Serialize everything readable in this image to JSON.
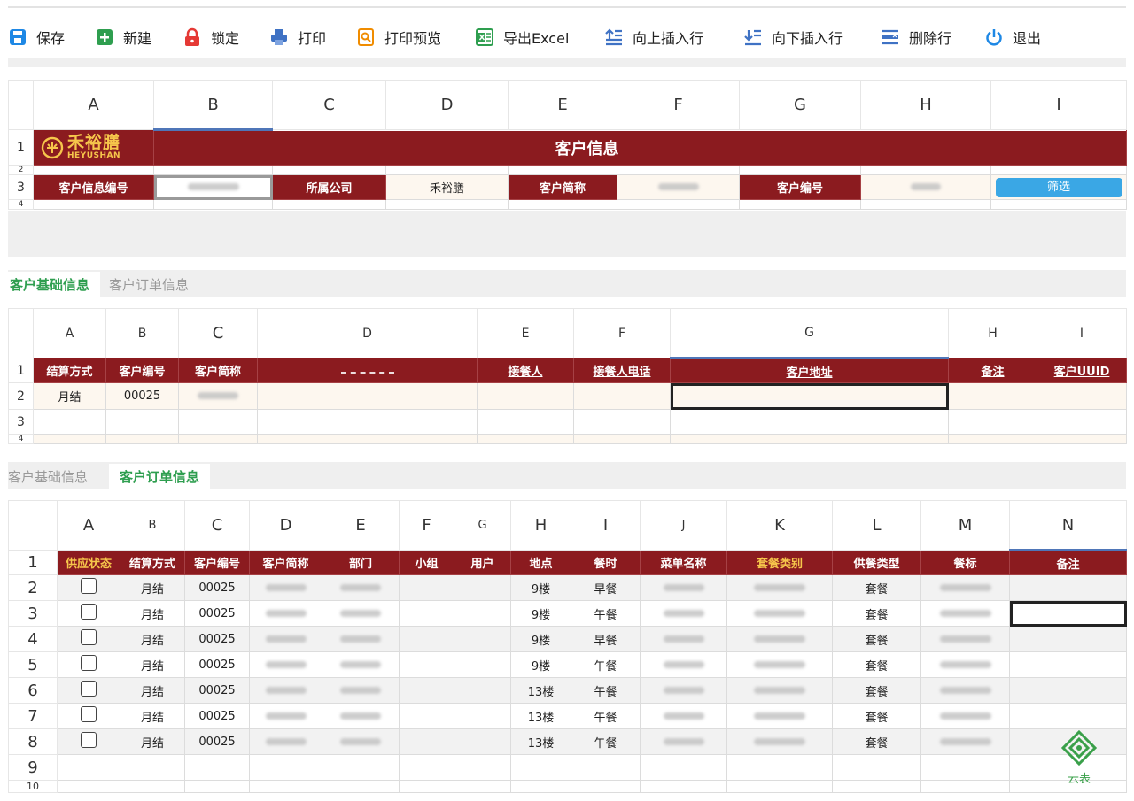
{
  "toolbar": {
    "buttons": [
      {
        "label": "保存",
        "icon": "save-icon",
        "color": "#1e88e5"
      },
      {
        "label": "新建",
        "icon": "new-icon",
        "color": "#2e9e4f"
      },
      {
        "label": "锁定",
        "icon": "lock-icon",
        "color": "#e53935"
      },
      {
        "label": "打印",
        "icon": "print-icon",
        "color": "#3f72c4"
      },
      {
        "label": "打印预览",
        "icon": "print-preview-icon",
        "color": "#f08c00"
      },
      {
        "label": "导出Excel",
        "icon": "excel-icon",
        "color": "#2e9e4f"
      },
      {
        "label": "向上插入行",
        "icon": "insert-row-above-icon",
        "color": "#3f72c4"
      },
      {
        "label": "向下插入行",
        "icon": "insert-row-below-icon",
        "color": "#3f72c4"
      },
      {
        "label": "删除行",
        "icon": "delete-row-icon",
        "color": "#3f72c4"
      },
      {
        "label": "退出",
        "icon": "power-icon",
        "color": "#1e88e5"
      }
    ]
  },
  "sheet1": {
    "cols": [
      "A",
      "B",
      "C",
      "D",
      "E",
      "F",
      "G",
      "H",
      "I"
    ],
    "rows": [
      "1",
      "2",
      "3",
      "4"
    ],
    "logo_cn": "禾裕膳",
    "logo_en": "HEYUSHAN",
    "title": "客户信息",
    "label_code": "客户信息编号",
    "label_company": "所属公司",
    "company_value": "禾裕膳",
    "label_short": "客户简称",
    "label_no": "客户编号",
    "filter_button": "筛选"
  },
  "tabs1": {
    "basic": "客户基础信息",
    "orders": "客户订单信息"
  },
  "sheet2": {
    "cols": [
      "A",
      "B",
      "C",
      "D",
      "E",
      "F",
      "G",
      "H",
      "I"
    ],
    "rows": [
      "1",
      "2",
      "3",
      "4"
    ],
    "headers": [
      "结算方式",
      "客户编号",
      "客户简称",
      "",
      "接餐人",
      "接餐人电话",
      "客户地址",
      "备注",
      "客户UUID"
    ],
    "row2": {
      "settle": "月结",
      "code": "00025"
    }
  },
  "tabs2": {
    "basic": "客户基础信息",
    "orders": "客户订单信息"
  },
  "sheet3": {
    "cols": [
      "A",
      "B",
      "C",
      "D",
      "E",
      "F",
      "G",
      "H",
      "I",
      "J",
      "K",
      "L",
      "M",
      "N"
    ],
    "rows": [
      "1",
      "2",
      "3",
      "4",
      "5",
      "6",
      "7",
      "8",
      "9",
      "10"
    ],
    "headers": [
      "供应状态",
      "结算方式",
      "客户编号",
      "客户简称",
      "部门",
      "小组",
      "用户",
      "地点",
      "餐时",
      "菜单名称",
      "套餐类别",
      "供餐类型",
      "餐标",
      "备注"
    ],
    "data": [
      {
        "settle": "月结",
        "code": "00025",
        "place": "9楼",
        "meal": "早餐",
        "type": "套餐"
      },
      {
        "settle": "月结",
        "code": "00025",
        "place": "9楼",
        "meal": "午餐",
        "type": "套餐"
      },
      {
        "settle": "月结",
        "code": "00025",
        "place": "9楼",
        "meal": "早餐",
        "type": "套餐"
      },
      {
        "settle": "月结",
        "code": "00025",
        "place": "9楼",
        "meal": "午餐",
        "type": "套餐"
      },
      {
        "settle": "月结",
        "code": "00025",
        "place": "13楼",
        "meal": "午餐",
        "type": "套餐"
      },
      {
        "settle": "月结",
        "code": "00025",
        "place": "13楼",
        "meal": "午餐",
        "type": "套餐"
      },
      {
        "settle": "月结",
        "code": "00025",
        "place": "13楼",
        "meal": "午餐",
        "type": "套餐"
      }
    ]
  },
  "corner_logo": {
    "text": "云表",
    "icon": "yunbiao-logo-icon"
  },
  "colors": {
    "maroon": "#8b1b1f",
    "gold": "#f6c64b",
    "green": "#2e9e4f",
    "blue": "#3aa7e5"
  }
}
